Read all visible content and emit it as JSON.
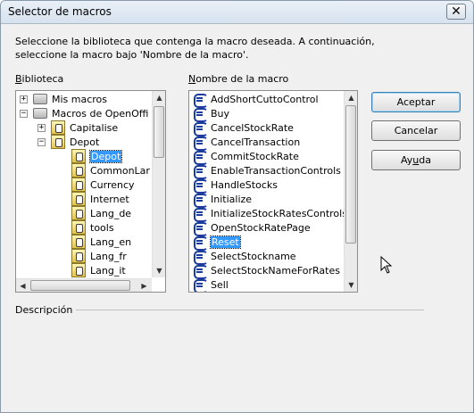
{
  "window": {
    "title": "Selector de macros"
  },
  "intro": {
    "line1": "Seleccione la biblioteca que contenga la macro deseada. A continuación,",
    "line2": "seleccione la macro bajo 'Nombre de la macro'."
  },
  "library": {
    "label_key": "B",
    "label_rest": "iblioteca",
    "items": [
      {
        "label": "Mis macros",
        "expander": "+"
      },
      {
        "label": "Macros de OpenOffi",
        "expander": "−"
      },
      {
        "label": "Capitalise",
        "expander": "+"
      },
      {
        "label": "Depot",
        "expander": "−"
      },
      {
        "label": "Depot",
        "selected": true
      },
      {
        "label": "CommonLar"
      },
      {
        "label": "Currency"
      },
      {
        "label": "Internet"
      },
      {
        "label": "Lang_de"
      },
      {
        "label": "tools"
      },
      {
        "label": "Lang_en"
      },
      {
        "label": "Lang_fr"
      },
      {
        "label": "Lang_it"
      }
    ]
  },
  "macros": {
    "label_key": "N",
    "label_rest": "ombre de la macro",
    "items": [
      "AddShortCuttoControl",
      "Buy",
      "CancelStockRate",
      "CancelTransaction",
      "CommitStockRate",
      "EnableTransactionControls",
      "HandleStocks",
      "Initialize",
      "InitializeStockRatesControls",
      "OpenStockRatePage",
      "Reset",
      "SelectStockname",
      "SelectStockNameForRates",
      "Sell"
    ],
    "selected": "Reset"
  },
  "buttons": {
    "accept": "Aceptar",
    "cancel": "Cancelar",
    "help_key": "u",
    "help_pre": "Ay",
    "help_post": "da"
  },
  "description": {
    "label": "Descripción"
  }
}
